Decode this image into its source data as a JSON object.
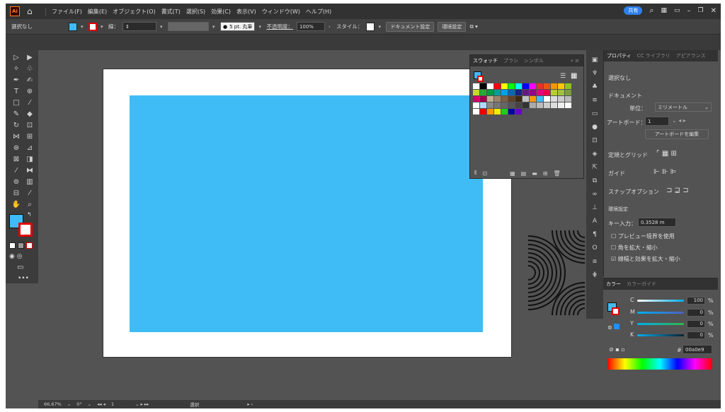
{
  "app": {
    "logo": "Ai",
    "home_icon": "home-icon"
  },
  "menu": [
    "ファイル(F)",
    "編集(E)",
    "オブジェクト(O)",
    "書式(T)",
    "選択(S)",
    "効果(C)",
    "表示(V)",
    "ウィンドウ(W)",
    "ヘルプ(H)"
  ],
  "menubar_right": {
    "share": "共有"
  },
  "control": {
    "selection": "選択なし",
    "stroke_label": "線：",
    "brush": "5 pt. 丸筆",
    "opacity_label": "不透明度：",
    "opacity_value": "100%",
    "style_label": "スタイル：",
    "doc_setup": "ドキュメント設定",
    "prefs": "環境設定"
  },
  "status": {
    "zoom": "66.67%",
    "rotate": "0°",
    "artboard": "1",
    "mode": "選択"
  },
  "swatches_panel": {
    "tabs": [
      "スウォッチ",
      "ブラシ",
      "シンボル"
    ]
  },
  "properties": {
    "tabs": [
      "プロパティ",
      "CC ライブラリ",
      "アピアランス"
    ],
    "selection": "選択なし",
    "document": "ドキュメント",
    "unit_label": "単位：",
    "unit_value": "ミリメートル",
    "artboard_label": "アートボード：",
    "artboard_value": "1",
    "edit_artboard": "アートボードを編集",
    "rulers_grids": "定規とグリッド",
    "guides": "ガイド",
    "snap": "スナップオプション",
    "prefs_section": "環境設定",
    "key_increment_label": "キー入力：",
    "key_increment_value": "0.3528 m",
    "preview_bounds": "プレビュー境界を使用",
    "scale_corners": "角を拡大・縮小",
    "scale_strokes": "線幅と効果を拡大・縮小"
  },
  "color_panel": {
    "tabs": [
      "カラー",
      "カラーガイド"
    ],
    "labels": [
      "C",
      "M",
      "Y",
      "K"
    ],
    "values": [
      "100",
      "0",
      "0",
      "0"
    ],
    "percent": "%",
    "hex_value": "00a0e9"
  },
  "colors": {
    "fill": "#3fbcf6",
    "accent": "#2f80ed"
  }
}
